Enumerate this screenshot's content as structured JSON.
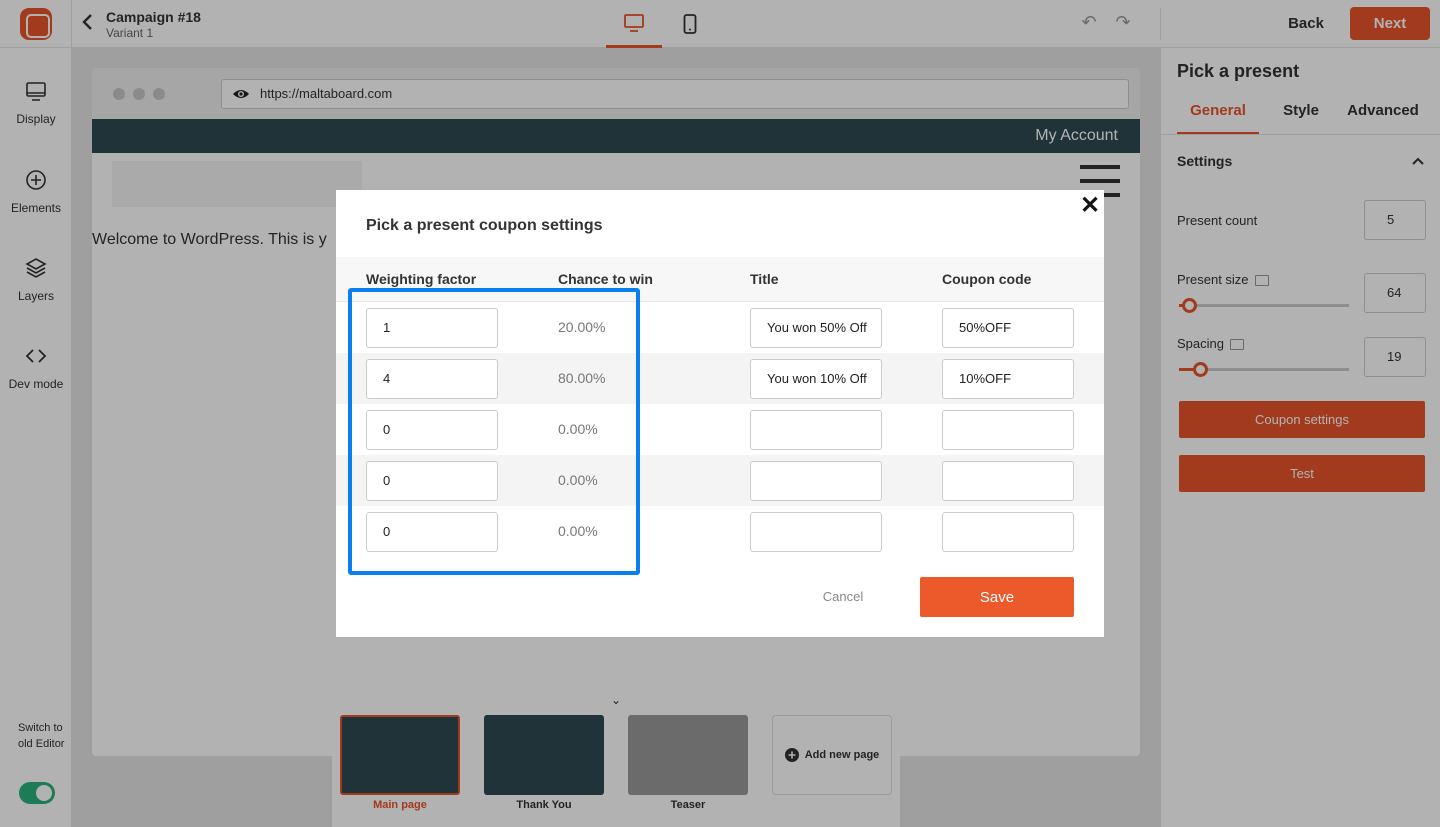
{
  "header": {
    "campaign_title": "Campaign #18",
    "variant": "Variant 1",
    "back_label": "Back",
    "next_label": "Next"
  },
  "sidebar": {
    "items": [
      {
        "label": "Display",
        "icon": "monitor-icon"
      },
      {
        "label": "Elements",
        "icon": "plus-circle-icon"
      },
      {
        "label": "Layers",
        "icon": "layers-icon"
      },
      {
        "label": "Dev mode",
        "icon": "code-icon"
      }
    ],
    "switch_label": "Switch to old Editor"
  },
  "browser": {
    "url": "https://maltaboard.com",
    "account_label": "My Account",
    "welcome_text": "Welcome to WordPress. This is y"
  },
  "right_panel": {
    "title": "Pick a present",
    "tabs": [
      "General",
      "Style",
      "Advanced"
    ],
    "active_tab": "General",
    "section": "Settings",
    "present_count_label": "Present count",
    "present_count": "5",
    "present_size_label": "Present size",
    "present_size": "64",
    "spacing_label": "Spacing",
    "spacing": "19",
    "coupon_settings_label": "Coupon settings",
    "test_label": "Test"
  },
  "pages": {
    "items": [
      {
        "label": "Main page",
        "active": true
      },
      {
        "label": "Thank You",
        "active": false
      },
      {
        "label": "Teaser",
        "active": false
      }
    ],
    "add_label": "Add new page"
  },
  "modal": {
    "title": "Pick a present coupon settings",
    "columns": [
      "Weighting factor",
      "Chance to win",
      "Title",
      "Coupon code"
    ],
    "rows": [
      {
        "weight": "1",
        "chance": "20.00%",
        "title": "You won 50% Off",
        "code": "50%OFF"
      },
      {
        "weight": "4",
        "chance": "80.00%",
        "title": "You won 10% Off",
        "code": "10%OFF"
      },
      {
        "weight": "0",
        "chance": "0.00%",
        "title": "",
        "code": ""
      },
      {
        "weight": "0",
        "chance": "0.00%",
        "title": "",
        "code": ""
      },
      {
        "weight": "0",
        "chance": "0.00%",
        "title": "",
        "code": ""
      }
    ],
    "cancel_label": "Cancel",
    "save_label": "Save"
  },
  "colors": {
    "accent": "#e8542a",
    "highlight": "#0a7ff0",
    "toggle_on": "#2ab27b"
  }
}
